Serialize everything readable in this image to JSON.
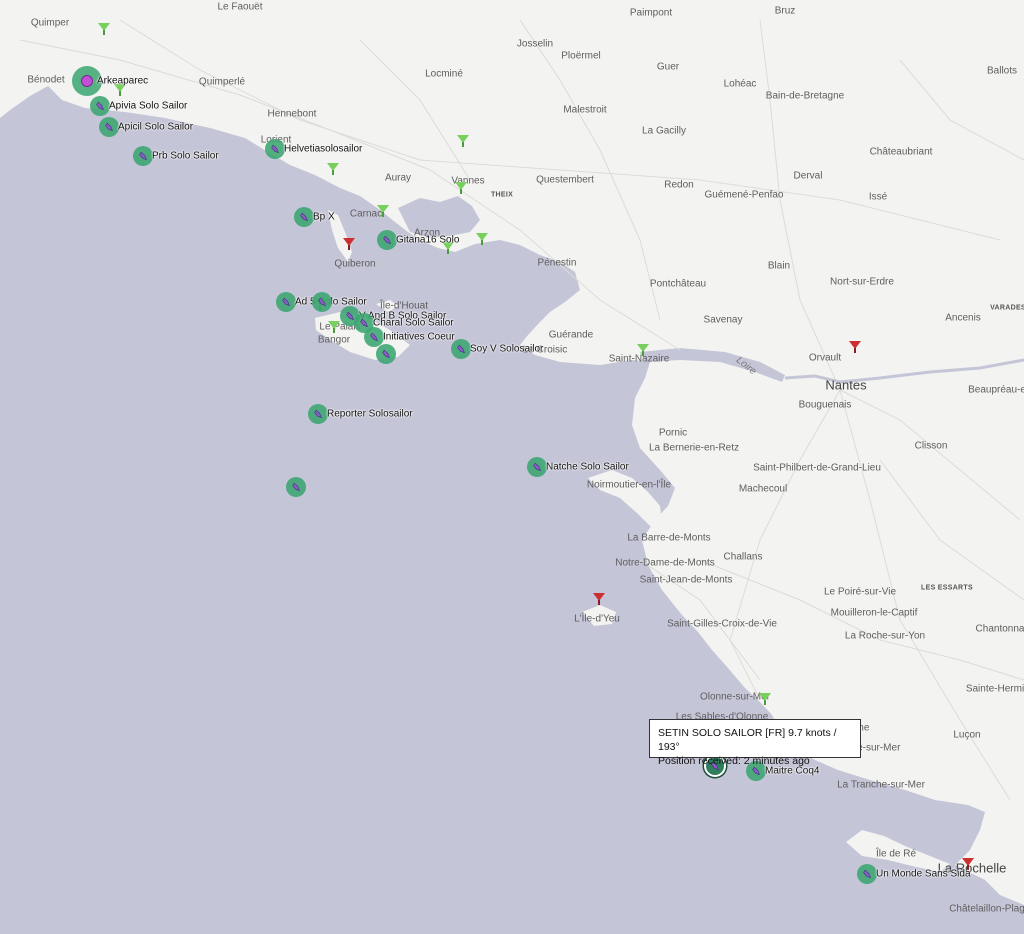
{
  "colors": {
    "sea": "#c5c5d8",
    "land": "#f3f3f1",
    "vessel_marker": "#3aa570",
    "vessel_icon": "#8a5fc9",
    "station_green": "#77d05d",
    "station_red": "#cc2f2f",
    "highlight_vessel": "#c34fd6"
  },
  "places": [
    {
      "name": "Quimper"
    },
    {
      "name": "Le Faouët"
    },
    {
      "name": "Paimpont"
    },
    {
      "name": "Bruz"
    },
    {
      "name": "Josselin"
    },
    {
      "name": "Ploërmel"
    },
    {
      "name": "Guer"
    },
    {
      "name": "Ballots"
    },
    {
      "name": "Bénodet"
    },
    {
      "name": "Quimperlé"
    },
    {
      "name": "Locminé"
    },
    {
      "name": "Lohéac"
    },
    {
      "name": "Bain-de-Bretagne"
    },
    {
      "name": "Hennebont"
    },
    {
      "name": "Malestroit"
    },
    {
      "name": "La Gacilly"
    },
    {
      "name": "Lorient"
    },
    {
      "name": "Châteaubriant"
    },
    {
      "name": "Auray"
    },
    {
      "name": "Vannes"
    },
    {
      "name": "Questembert"
    },
    {
      "name": "Redon"
    },
    {
      "name": "Derval"
    },
    {
      "name": "THEIX"
    },
    {
      "name": "Guémené-Penfao"
    },
    {
      "name": "Issé"
    },
    {
      "name": "Carnac"
    },
    {
      "name": "Arzon"
    },
    {
      "name": "Quiberon"
    },
    {
      "name": "Pénestin"
    },
    {
      "name": "Blain"
    },
    {
      "name": "Pontchâteau"
    },
    {
      "name": "Nort-sur-Erdre"
    },
    {
      "name": "Île-d'Houat"
    },
    {
      "name": "Savenay"
    },
    {
      "name": "VARADES"
    },
    {
      "name": "Ancenis"
    },
    {
      "name": "Le Palais"
    },
    {
      "name": "Bangor"
    },
    {
      "name": "Guérande"
    },
    {
      "name": "Le Croisic"
    },
    {
      "name": "Saint-Nazaire"
    },
    {
      "name": "Loire"
    },
    {
      "name": "Orvault"
    },
    {
      "name": "Nantes"
    },
    {
      "name": "Beaupréau-e"
    },
    {
      "name": "Bouguenais"
    },
    {
      "name": "Pornic"
    },
    {
      "name": "La Bernerie-en-Retz"
    },
    {
      "name": "Clisson"
    },
    {
      "name": "Saint-Philbert-de-Grand-Lieu"
    },
    {
      "name": "Noirmoutier-en-l'Île"
    },
    {
      "name": "Machecoul"
    },
    {
      "name": "La Barre-de-Monts"
    },
    {
      "name": "Challans"
    },
    {
      "name": "Notre-Dame-de-Monts"
    },
    {
      "name": "Saint-Jean-de-Monts"
    },
    {
      "name": "LES ESSARTS"
    },
    {
      "name": "Le Poiré-sur-Vie"
    },
    {
      "name": "Mouilleron-le-Captif"
    },
    {
      "name": "L'Île-d'Yeu"
    },
    {
      "name": "Saint-Gilles-Croix-de-Vie"
    },
    {
      "name": "Chantonna"
    },
    {
      "name": "La Roche-sur-Yon"
    },
    {
      "name": "Sainte-Hermi"
    },
    {
      "name": "Olonne-sur-Mer"
    },
    {
      "name": "Les Sables-d'Olonne"
    },
    {
      "name": "Luçon"
    },
    {
      "name": "Château-d'Olonne"
    },
    {
      "name": "Longeville-sur-Mer"
    },
    {
      "name": "La Tranche-sur-Mer"
    },
    {
      "name": "Île de Ré"
    },
    {
      "name": "La Rochelle"
    },
    {
      "name": "Châtelaillon-Plag"
    }
  ],
  "vessels": [
    {
      "name": "Arkeaparec",
      "size": "large",
      "highlight": true
    },
    {
      "name": "Apivia Solo Sailor"
    },
    {
      "name": "Apicil Solo Sailor"
    },
    {
      "name": "Prb Solo Sailor"
    },
    {
      "name": "Helvetiasolosailor"
    },
    {
      "name": "Bp X"
    },
    {
      "name": "Gitana16 Solo"
    },
    {
      "name": "Ad 5 Solo Sailor"
    },
    {
      "name": ""
    },
    {
      "name": "V And B Solo Sailor"
    },
    {
      "name": "Charal Solo Sailor"
    },
    {
      "name": "Initiatives Coeur"
    },
    {
      "name": ""
    },
    {
      "name": "Soy V Solosailor"
    },
    {
      "name": "Reporter Solosailor"
    },
    {
      "name": "Natche Solo Sailor"
    },
    {
      "name": ""
    },
    {
      "name": "",
      "selected": true
    },
    {
      "name": "Maitre Coq4"
    },
    {
      "name": "Un Monde Sans Sida"
    }
  ],
  "stations": [
    {
      "color": "green"
    },
    {
      "color": "green"
    },
    {
      "color": "green"
    },
    {
      "color": "green"
    },
    {
      "color": "green"
    },
    {
      "color": "green"
    },
    {
      "color": "red"
    },
    {
      "color": "green"
    },
    {
      "color": "green"
    },
    {
      "color": "green"
    },
    {
      "color": "green"
    },
    {
      "color": "green"
    },
    {
      "color": "red"
    },
    {
      "color": "red"
    },
    {
      "color": "green"
    },
    {
      "color": "red"
    }
  ],
  "tooltip": {
    "line1": "SETIN SOLO SAILOR [FR] 9.7 knots / 193°",
    "line2": "Position received: 2 minutes ago"
  }
}
